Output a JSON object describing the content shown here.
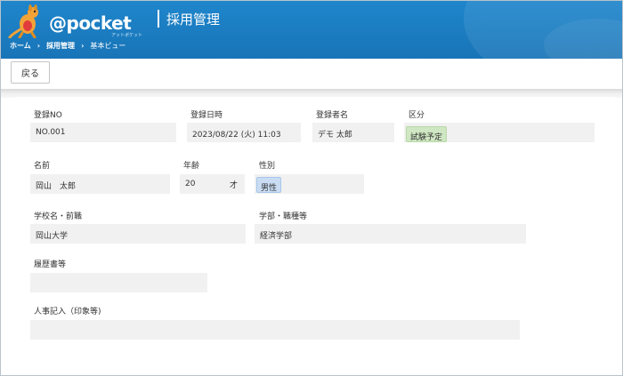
{
  "brand": {
    "logo_text": "@pocket",
    "logo_sub": "アットポケット"
  },
  "app": {
    "title": "採用管理"
  },
  "breadcrumb": [
    "ホーム",
    "採用管理",
    "基本ビュー"
  ],
  "toolbar": {
    "back_label": "戻る"
  },
  "form": {
    "reg_no": {
      "label": "登録NO",
      "value": "NO.001"
    },
    "reg_datetime": {
      "label": "登録日時",
      "value": "2023/08/22 (火) 11:03"
    },
    "registrant": {
      "label": "登録者名",
      "value": "デモ 太郎"
    },
    "category": {
      "label": "区分",
      "value": "試験予定"
    },
    "name": {
      "label": "名前",
      "value": "岡山　太郎"
    },
    "age": {
      "label": "年齢",
      "value": "20",
      "unit": "才"
    },
    "gender": {
      "label": "性別",
      "value": "男性"
    },
    "school": {
      "label": "学校名・前職",
      "value": "岡山大学"
    },
    "faculty": {
      "label": "学部・職種等",
      "value": "経済学部"
    },
    "resume": {
      "label": "履歴書等",
      "value": ""
    },
    "hr_notes": {
      "label": "人事記入（印象等)",
      "value": ""
    }
  },
  "colors": {
    "header": "#1a7cc2",
    "badge_green": "#cfe7c2",
    "badge_blue": "#c9dcf3"
  }
}
